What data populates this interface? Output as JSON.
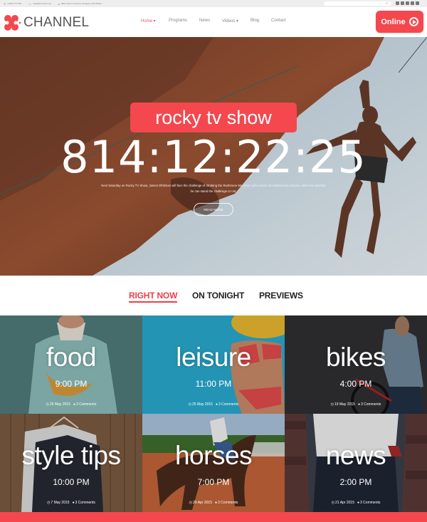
{
  "topbar": {
    "phone": "1-800-777-555",
    "email": "mail@demolink.org",
    "address": "8901 Marmora Road, Glasgow, D04 89GR",
    "search_placeholder": "",
    "social_icons": [
      "facebook-icon",
      "google-plus-icon",
      "twitter-icon",
      "dribbble-icon",
      "instagram-icon"
    ]
  },
  "header": {
    "logo_text": "CHANNEL",
    "nav": [
      {
        "label": "Home",
        "active": true,
        "has_dropdown": true
      },
      {
        "label": "Programs",
        "active": false,
        "has_dropdown": false
      },
      {
        "label": "News",
        "active": false,
        "has_dropdown": false
      },
      {
        "label": "Videos",
        "active": false,
        "has_dropdown": true
      },
      {
        "label": "Blog",
        "active": false,
        "has_dropdown": false
      },
      {
        "label": "Contact",
        "active": false,
        "has_dropdown": false
      }
    ],
    "online_label": "Online"
  },
  "hero": {
    "title": "rocky tv show",
    "countdown": "814:12:22:25",
    "description": "Next Saturday on Rocky TV Show, James Whitman will face the challenge of climbing the Rushmore Mountain with a team of professional climbers. We'll see whether he can stand the challenge or not.",
    "read_more": "READ MORE"
  },
  "tabs": [
    {
      "label": "RIGHT NOW",
      "active": true
    },
    {
      "label": "ON TONIGHT",
      "active": false
    },
    {
      "label": "PREVIEWS",
      "active": false
    }
  ],
  "shows": [
    {
      "title": "food",
      "time": "9:00 PM",
      "date": "25 May 2015",
      "comments": "3 Comments"
    },
    {
      "title": "leisure",
      "time": "11:00 PM",
      "date": "25 May 2015",
      "comments": "3 Comments"
    },
    {
      "title": "bikes",
      "time": "4:00 PM",
      "date": "19 May 2015",
      "comments": "3 Comments"
    },
    {
      "title": "style tips",
      "time": "10:00 PM",
      "date": "7 May 2015",
      "comments": "3 Comments"
    },
    {
      "title": "horses",
      "time": "7:00 PM",
      "date": "29 Apr 2015",
      "comments": "3 Comments"
    },
    {
      "title": "news",
      "time": "2:00 PM",
      "date": "21 Apr 2015",
      "comments": "3 Comments"
    }
  ],
  "colors": {
    "accent": "#f5474e",
    "tab_active": "#ec3f48",
    "topbar_bg": "#eeeeee"
  }
}
